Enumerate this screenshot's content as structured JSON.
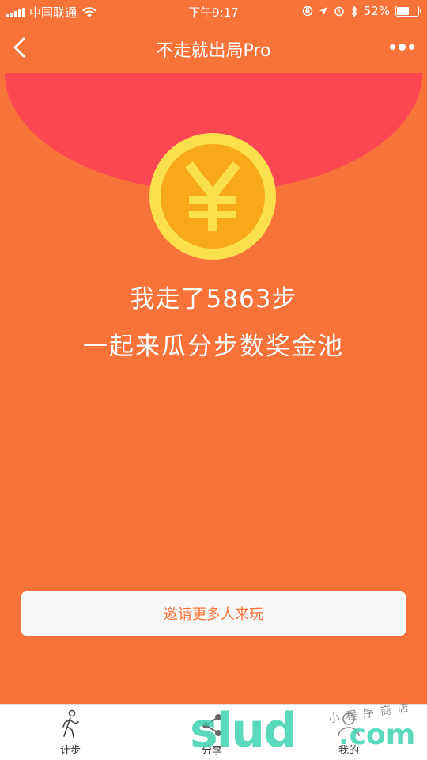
{
  "status_bar": {
    "carrier": "中国联通",
    "time": "下午9:17",
    "battery": "52%",
    "battery_level": 0.52
  },
  "nav": {
    "title": "不走就出局Pro"
  },
  "coin": {
    "symbol": "¥"
  },
  "main": {
    "steps_text": "我走了5863步",
    "subtitle": "一起来瓜分步数奖金池",
    "invite_button": "邀请更多人来玩"
  },
  "tabs": [
    {
      "label": "计步",
      "icon": "walking-icon"
    },
    {
      "label": "分享",
      "icon": "share-icon"
    },
    {
      "label": "我的",
      "icon": "user-icon"
    }
  ],
  "watermark": {
    "brand": "slud",
    "suffix": ".com",
    "small_text": "小程序商店"
  },
  "colors": {
    "background": "#f7733a",
    "flap": "#fa4752",
    "coin_outer": "#fbe04d",
    "coin_inner": "#f7a81b",
    "button_text": "#f7733a"
  }
}
